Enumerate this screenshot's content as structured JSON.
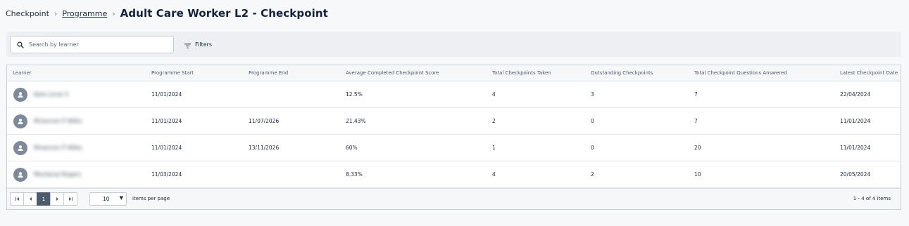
{
  "breadcrumb": {
    "root": "Checkpoint",
    "programme": "Programme",
    "title": "Adult Care Worker L2 - Checkpoint"
  },
  "toolbar": {
    "search_placeholder": "Search by learner",
    "filters_label": "Filters"
  },
  "table": {
    "columns": {
      "learner": "Learner",
      "programme_start": "Programme Start",
      "programme_end": "Programme End",
      "avg_score": "Average Completed Checkpoint Score",
      "total_taken": "Total Checkpoints Taken",
      "outstanding": "Outstanding Checkpoints",
      "questions_answered": "Total Checkpoint Questions Answered",
      "latest_date": "Latest Checkpoint Date"
    },
    "rows": [
      {
        "learner": "Kyle Lorne S",
        "programme_start": "11/01/2024",
        "programme_end": "",
        "avg_score": "12.5%",
        "total_taken": "4",
        "outstanding": "3",
        "questions_answered": "7",
        "latest_date": "22/04/2024"
      },
      {
        "learner": "Rhiannon P Wilks",
        "programme_start": "11/01/2024",
        "programme_end": "11/07/2026",
        "avg_score": "21.43%",
        "total_taken": "2",
        "outstanding": "0",
        "questions_answered": "7",
        "latest_date": "11/01/2024"
      },
      {
        "learner": "Rhiannon P Wilks",
        "programme_start": "11/01/2024",
        "programme_end": "13/11/2026",
        "avg_score": "60%",
        "total_taken": "1",
        "outstanding": "0",
        "questions_answered": "20",
        "latest_date": "11/01/2024"
      },
      {
        "learner": "Montanal Rogers",
        "programme_start": "11/03/2024",
        "programme_end": "",
        "avg_score": "8.33%",
        "total_taken": "4",
        "outstanding": "2",
        "questions_answered": "10",
        "latest_date": "20/05/2024"
      }
    ]
  },
  "footer": {
    "current_page": "1",
    "page_size": "10",
    "items_per_page_label": "items per page",
    "range_info": "1 - 4 of 4 items"
  }
}
